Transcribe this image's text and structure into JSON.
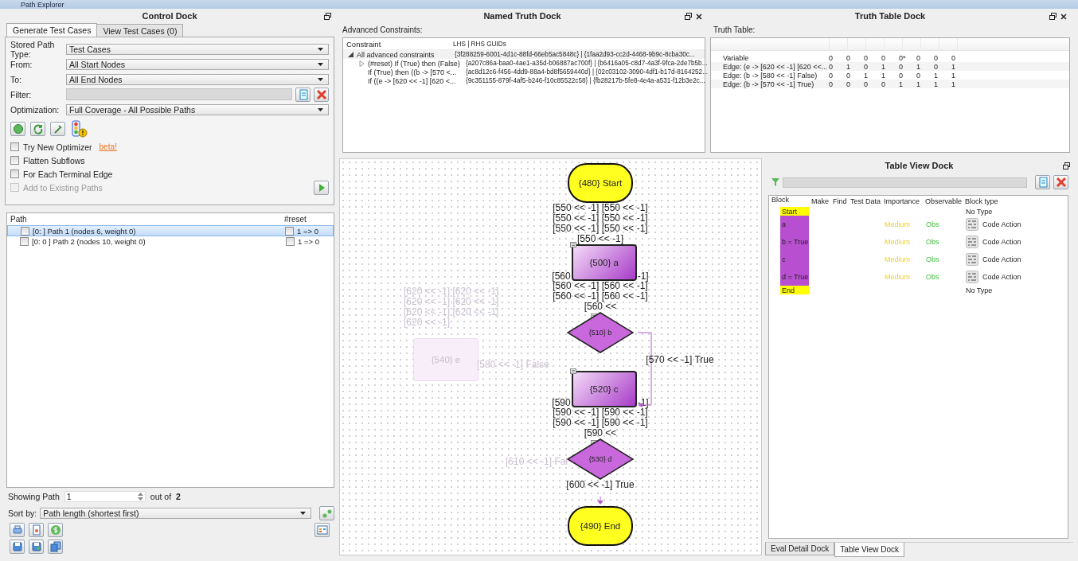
{
  "window": {
    "title": "Path Explorer"
  },
  "control_dock": {
    "title": "Control Dock",
    "tabs": [
      {
        "label": "Generate Test Cases",
        "selected": true
      },
      {
        "label": "View Test Cases (0)",
        "selected": false
      }
    ],
    "fields": [
      {
        "kind": "select",
        "label": "Stored Path Type:",
        "value": "Test Cases"
      },
      {
        "kind": "select",
        "label": "From:",
        "value": "All Start Nodes"
      },
      {
        "kind": "select",
        "label": "To:",
        "value": "All End Nodes"
      },
      {
        "kind": "filter",
        "label": "Filter:"
      },
      {
        "kind": "select",
        "label": "Optimization:",
        "value": "Full Coverage - All Possible Paths"
      }
    ],
    "options": [
      {
        "label": "Try New Optimizer",
        "checked": false,
        "disabled": false,
        "link": "beta!"
      },
      {
        "label": "Flatten Subflows",
        "checked": false,
        "disabled": false
      },
      {
        "label": "For Each Terminal Edge",
        "checked": false,
        "disabled": false
      },
      {
        "label": "Add to Existing Paths",
        "checked": false,
        "disabled": true
      }
    ],
    "paths": {
      "columns": [
        "Path",
        "#reset"
      ],
      "rows": [
        {
          "label": "[0: ] Path 1 (nodes 6, weight 0)",
          "checked": false,
          "reset_checked": false,
          "reset": "1 => 0",
          "selected": true
        },
        {
          "label": "[0: 0 ] Path 2 (nodes 10, weight 0)",
          "checked": false,
          "reset_checked": false,
          "reset": "1 => 0",
          "selected": false
        }
      ]
    },
    "showing_path": {
      "label": "Showing Path",
      "value": "1",
      "out_of": "out of",
      "total": "2"
    },
    "sort": {
      "label": "Sort by:",
      "value": "Path length (shortest first)"
    }
  },
  "named_truth_dock": {
    "title": "Named Truth Dock",
    "label": "Advanced Constraints:",
    "columns": [
      "Constraint",
      "LHS | RHS GUIDs"
    ],
    "rows": [
      {
        "constraint": "All advanced constraints",
        "guids": "{3f288259-6001-4d1c-88fd-66eb5ac5848c} | {1faa2d93-cc2d-4468-9b9c-8cba30c...",
        "expanded": true,
        "children": [
          {
            "constraint": "(#reset)  If (True) then (False)",
            "guids": "{a207c86a-baa0-4ae1-a35d-b06887ac700f} | {b6416a05-c8d7-4a3f-9fca-2de7b5b...",
            "expanded": false
          },
          {
            "constraint": "If (True) then ((b -> [570 <...",
            "guids": "{ac8d12c6-f456-4dd9-88a4-bd8f5659440d} | {02c03102-3090-4df1-b17d-8164252..."
          },
          {
            "constraint": "If ((e -> [620 << -1] [620 <...",
            "guids": "{9c351155-879f-4af5-b246-f10c85522c58} | {fb28217b-5fe8-4e4a-a531-f12b3e2c..."
          }
        ]
      }
    ]
  },
  "truth_table_dock": {
    "title": "Truth Table Dock",
    "label": "Truth Table:",
    "rows": [
      {
        "label": "Variable",
        "values": [
          "0",
          "0",
          "0",
          "0",
          "0*",
          "0",
          "0",
          "0"
        ]
      },
      {
        "label": "Edge: (e -> [620 << -1] [620 <<...",
        "values": [
          "0",
          "1",
          "0",
          "1",
          "0",
          "1",
          "0",
          "1"
        ]
      },
      {
        "label": "Edge: (b -> [580 << -1] False)",
        "values": [
          "0",
          "0",
          "1",
          "1",
          "0",
          "0",
          "1",
          "1"
        ]
      },
      {
        "label": "Edge: (b -> [570 << -1] True)",
        "values": [
          "0",
          "0",
          "0",
          "0",
          "1",
          "1",
          "1",
          "1"
        ]
      }
    ]
  },
  "flow": {
    "chain": [
      {
        "kind": "terminal",
        "label": "{480} Start"
      },
      {
        "kind": "labels",
        "lines": [
          "[550 << -1] [550 << -1]",
          "[550 << -1] [550 << -1]",
          "[550 << -1] [550 << -1]",
          "[550 << -1]"
        ]
      },
      {
        "kind": "process",
        "label": "{500} a",
        "fragments": [
          "[560",
          "-1]"
        ]
      },
      {
        "kind": "labels",
        "lines": [
          "[560 << -1] [560 << -1]",
          "[560 << -1] [560 << -1]",
          "[560 <<"
        ]
      },
      {
        "kind": "decision",
        "label": "{510} b",
        "branch": "[570 << -1] True"
      },
      {
        "kind": "process",
        "label": "{520} c",
        "fragments": [
          "[590",
          "-1]"
        ]
      },
      {
        "kind": "labels",
        "lines": [
          "[590 << -1] [590 << -1]",
          "[590 << -1] [590 << -1]",
          "[590 <<"
        ]
      },
      {
        "kind": "decision",
        "label": "{530} d"
      },
      {
        "kind": "labels",
        "lines": [
          "[600 << -1] True"
        ]
      },
      {
        "kind": "terminal",
        "label": "{490} End"
      }
    ],
    "faded": [
      {
        "kind": "labels",
        "lines": [
          "[620 << -1] [620 << -1]",
          "[620 << -1] [620 << -1]",
          "[620 << -1] [620 << -1]",
          "[620 << -1]"
        ]
      },
      {
        "kind": "node",
        "label": "{540} e"
      },
      {
        "kind": "label",
        "text": "[580 << -1] False"
      },
      {
        "kind": "label",
        "text": "[610 << -1] Fal"
      }
    ]
  },
  "table_view_dock": {
    "title": "Table View Dock",
    "columns": [
      "Block",
      "Make",
      "Find",
      "Test Data",
      "Importance",
      "Observable",
      "Block type"
    ],
    "rows": [
      {
        "block": "Start",
        "color": "#ffff00",
        "block_type": "No Type"
      },
      {
        "block": "a",
        "color": "#b84fd0",
        "importance": "Medium",
        "observable": "Obs",
        "block_type": "Code Action",
        "kind": "code_action"
      },
      {
        "block": "b = True",
        "color": "#b84fd0",
        "importance": "Medium",
        "observable": "Obs",
        "block_type": "Code Action",
        "kind": "code_action"
      },
      {
        "block": "c",
        "color": "#b84fd0",
        "importance": "Medium",
        "observable": "Obs",
        "block_type": "Code Action",
        "kind": "code_action"
      },
      {
        "block": "d = True",
        "color": "#b84fd0",
        "importance": "Medium",
        "observable": "Obs",
        "block_type": "Code Action",
        "kind": "code_action"
      },
      {
        "block": "End",
        "color": "#ffff00",
        "block_type": "No Type"
      }
    ]
  },
  "bottom_tabs": [
    {
      "label": "Eval Detail Dock",
      "selected": false
    },
    {
      "label": "Table View Dock",
      "selected": true
    }
  ]
}
